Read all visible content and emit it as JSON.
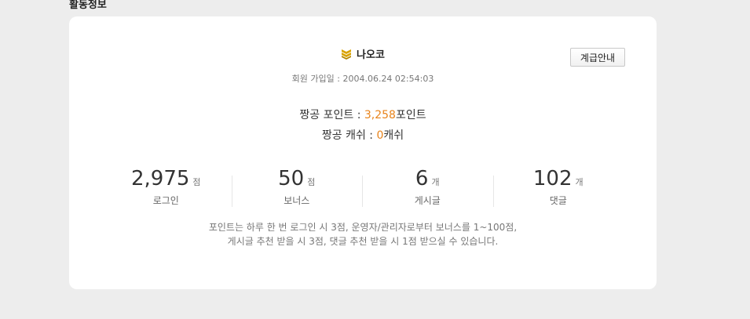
{
  "section_title": "활동정보",
  "profile": {
    "username": "나오코",
    "join_label": "회원 가입일 : ",
    "join_date": "2004.06.24 02:54:03",
    "grade_button": "계급안내"
  },
  "points": {
    "label": "짱공 포인트 : ",
    "value": "3,258",
    "unit": "포인트"
  },
  "cash": {
    "label": "짱공 캐쉬 : ",
    "value": "0",
    "unit": "캐쉬"
  },
  "stats": [
    {
      "value": "2,975",
      "unit": "점",
      "label": "로그인"
    },
    {
      "value": "50",
      "unit": "점",
      "label": "보너스"
    },
    {
      "value": "6",
      "unit": "개",
      "label": "게시글"
    },
    {
      "value": "102",
      "unit": "개",
      "label": "댓글"
    }
  ],
  "notice": {
    "line1": "포인트는 하루 한 번 로그인 시 3점, 운영자/관리자로부터 보너스를 1~100점,",
    "line2": "게시글 추천 받을 시 3점, 댓글 추천 받을 시 1점 받으실 수 있습니다."
  },
  "colors": {
    "accent": "#e8831a",
    "rank_icon": "#d9a300",
    "background": "#ededed",
    "card": "#ffffff"
  },
  "icons": {
    "rank": "rank-chevron-icon"
  }
}
